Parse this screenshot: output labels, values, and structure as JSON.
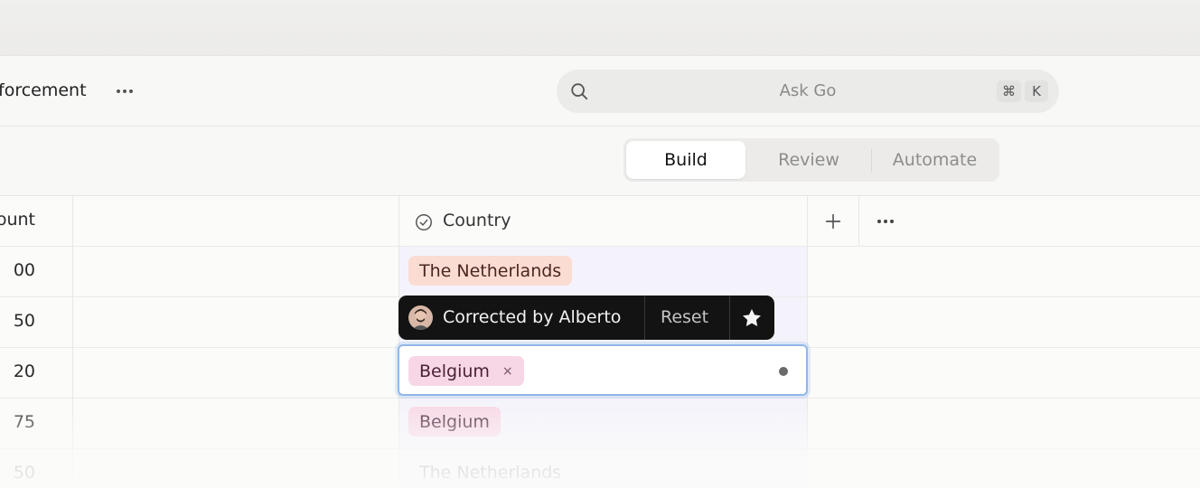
{
  "header": {
    "title": "forcement",
    "more_icon": "more-horizontal-icon"
  },
  "search": {
    "placeholder": "Ask Go",
    "shortcut_keys": [
      "⌘",
      "K"
    ]
  },
  "tabs": [
    {
      "label": "Build",
      "active": true
    },
    {
      "label": "Review",
      "active": false
    },
    {
      "label": "Automate",
      "active": false
    }
  ],
  "table": {
    "columns": [
      {
        "label": "ount"
      },
      {
        "label": ""
      },
      {
        "label": "Country",
        "icon": "check-circle-icon"
      }
    ],
    "add_column_icon": "plus-icon",
    "column_more_icon": "more-horizontal-icon",
    "rows": [
      {
        "amount": "00",
        "country": "The Netherlands"
      },
      {
        "amount": "50",
        "country": ""
      },
      {
        "amount": "20",
        "country": "Belgium"
      },
      {
        "amount": "75",
        "country": "Belgium"
      },
      {
        "amount": "50",
        "country": "The Netherlands"
      }
    ]
  },
  "tooltip": {
    "text": "Corrected by Alberto",
    "reset_label": "Reset",
    "star_icon": "star-icon"
  },
  "editing_cell": {
    "remove_icon": "×"
  },
  "colors": {
    "tag_netherlands_bg": "#fbdcd3",
    "tag_belgium_bg": "#f7d7e6",
    "focus_border": "#8fb7e8",
    "tooltip_bg": "#131313"
  }
}
